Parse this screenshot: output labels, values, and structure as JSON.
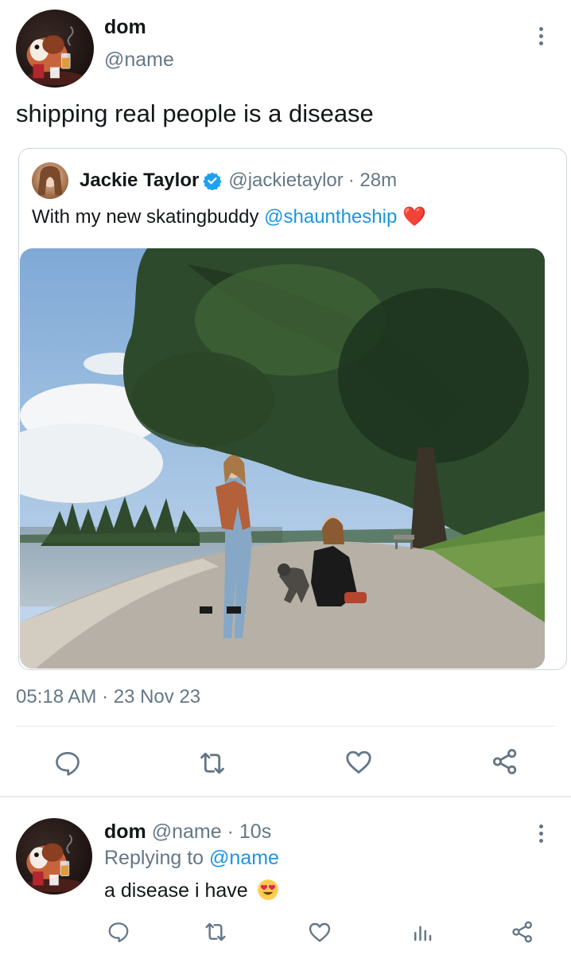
{
  "main_tweet": {
    "display_name": "dom",
    "handle": "@name",
    "text": "shipping real people is a disease",
    "timestamp": "05:18 AM · 23 Nov 23"
  },
  "quoted_tweet": {
    "display_name": "Jackie Taylor",
    "handle": "@jackietaylor",
    "time_ago": "· 28m",
    "text_before": "With my new skatingbuddy",
    "mention": "@shauntheship",
    "emoji": "❤️"
  },
  "actions": [
    "reply-icon",
    "retweet-icon",
    "like-icon",
    "share-icon"
  ],
  "reply": {
    "display_name": "dom",
    "handle": "@name",
    "time_ago": "· 10s",
    "replying_label": "Replying to",
    "replying_handle": "@name",
    "text": "a disease i have",
    "emoji": "😍",
    "actions": [
      "reply-icon",
      "retweet-icon",
      "like-icon",
      "analytics-icon",
      "share-icon"
    ]
  },
  "colors": {
    "accent": "#1b95e0",
    "muted": "#657786",
    "verified": "#1da1f2",
    "divider": "#e6ecf0"
  }
}
